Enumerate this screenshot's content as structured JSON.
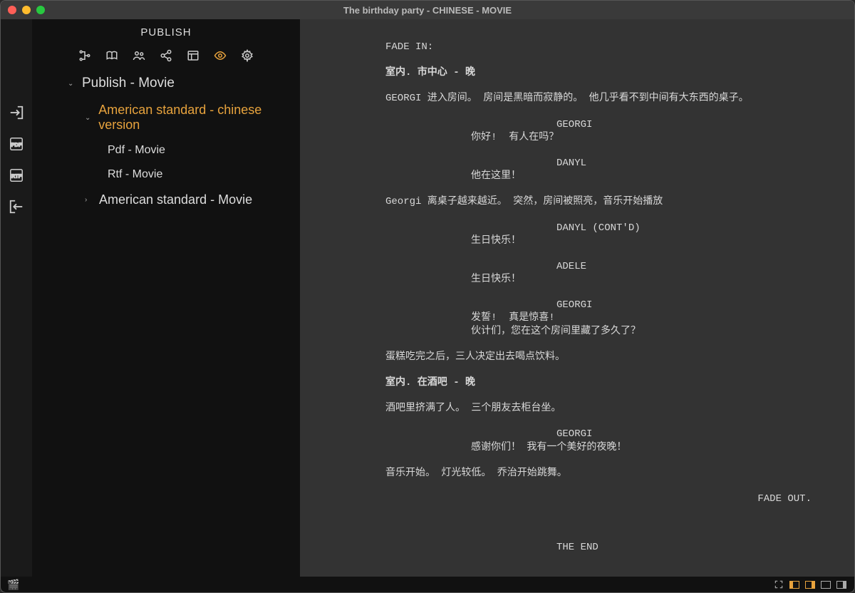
{
  "window": {
    "title": "The birthday party - CHINESE - MOVIE"
  },
  "sidebar": {
    "title": "PUBLISH",
    "tree": {
      "root": {
        "label": "Publish - Movie",
        "expanded": true
      },
      "child1": {
        "label": "American standard - chinese version",
        "expanded": true,
        "selected": true
      },
      "leaf1": {
        "label": "Pdf - Movie"
      },
      "leaf2": {
        "label": "Rtf - Movie"
      },
      "child2": {
        "label": "American standard - Movie",
        "expanded": false
      }
    }
  },
  "script": {
    "fadein": "FADE IN:",
    "scene1": "室内. 市中心 - 晚",
    "action1": "GEORGI 进入房间。 房间是黑暗而寂静的。 他几乎看不到中间有大东西的桌子。",
    "char1": "GEORGI",
    "dlg1": "你好!  有人在吗？",
    "char2": "DANYL",
    "dlg2": "他在这里！",
    "action2": "Georgi 离桌子越来越近。 突然，房间被照亮，音乐开始播放",
    "char3": "DANYL (CONT'D)",
    "dlg3": "生日快乐！",
    "char4": "ADELE",
    "dlg4": "生日快乐！",
    "char5": "GEORGI",
    "dlg5": "发誓!  真是惊喜!\n伙计们，您在这个房间里藏了多久了？",
    "action3": "蛋糕吃完之后，三人决定出去喝点饮料。",
    "scene2": "室内. 在酒吧 - 晚",
    "action4": "酒吧里挤满了人。 三个朋友去柜台坐。",
    "char6": "GEORGI",
    "dlg6": "感谢你们！ 我有一个美好的夜晚！",
    "action5": "音乐开始。 灯光较低。 乔治开始跳舞。",
    "fadeout": "FADE OUT.",
    "end": "THE END"
  }
}
